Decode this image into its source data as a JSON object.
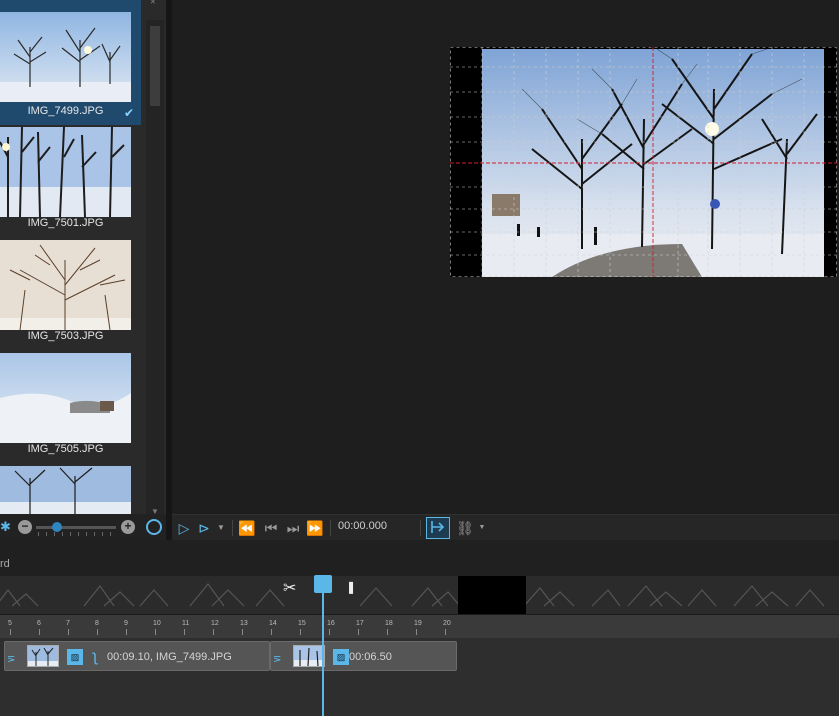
{
  "browser": {
    "items": [
      {
        "label": "IMG_7499.JPG",
        "selected": true
      },
      {
        "label": "IMG_7501.JPG",
        "selected": false
      },
      {
        "label": "IMG_7503.JPG",
        "selected": false
      },
      {
        "label": "IMG_7505.JPG",
        "selected": false
      },
      {
        "label": "",
        "selected": false
      }
    ],
    "zoom_minus": "−",
    "zoom_plus": "+"
  },
  "transport": {
    "timecode": "00:00.000",
    "play_icon": "play-icon",
    "play_range_icon": "play-range-icon",
    "rewind_icon": "rewind-icon",
    "prev_frame_icon": "step-back-icon",
    "next_frame_icon": "step-forward-icon",
    "fast_forward_icon": "fast-forward-icon",
    "cursor_toggle_icon": "cursor-toggle-icon",
    "link_icon": "link-icon"
  },
  "timeline": {
    "label": "rd",
    "ruler_ticks": [
      "5",
      "6",
      "7",
      "8",
      "9",
      "10",
      "11",
      "12",
      "13",
      "14",
      "15",
      "16",
      "17",
      "18",
      "19",
      "20"
    ],
    "clips": [
      {
        "duration": "00:09.10",
        "name": "IMG_7499.JPG",
        "text": "00:09.10, IMG_7499.JPG"
      },
      {
        "duration": "00:06.50",
        "text": "00:06.50"
      }
    ]
  },
  "colors": {
    "accent": "#5bb7e8",
    "selection": "#1f4a6e",
    "background": "#1b1b1b"
  }
}
